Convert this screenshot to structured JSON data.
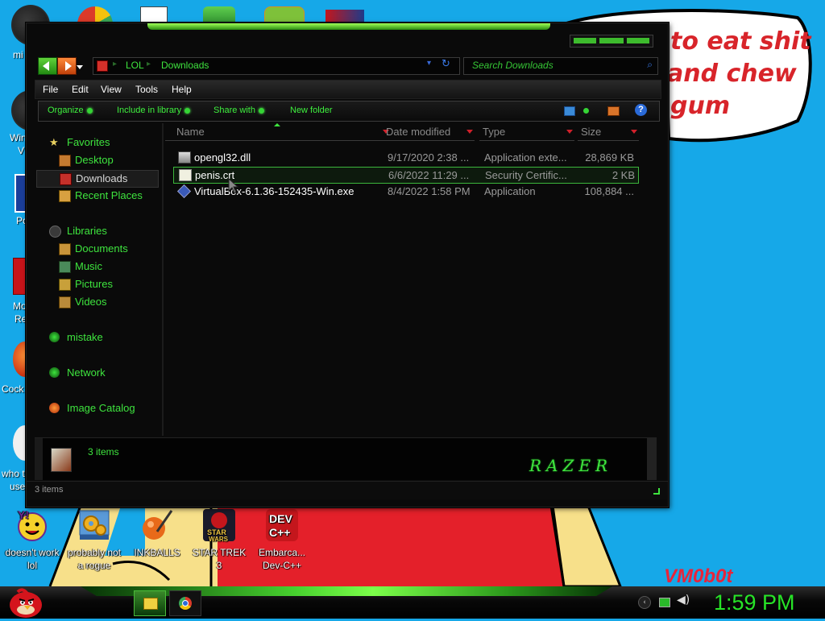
{
  "wallpaper": {
    "bubble_lines": [
      "to eat shit",
      "and chew",
      "gum"
    ],
    "signature": "VM0b0t"
  },
  "desktop_icons": [
    {
      "label": "doesn't work lol",
      "icon": "yahoo-messenger-icon"
    },
    {
      "label": "probably not a rogue",
      "icon": "gears-installer-icon"
    },
    {
      "label": "INKBALLS",
      "icon": "inkballs-icon"
    },
    {
      "label": "STAR TREK 3",
      "icon": "star-trek-icon"
    },
    {
      "label": "Embarca... Dev-C++",
      "icon": "dev-cpp-icon"
    }
  ],
  "desktop_cut_labels": [
    "mi",
    "Win",
    "V",
    "Po",
    "Mo",
    "Re",
    "Cock",
    "who t",
    "use"
  ],
  "window": {
    "address": {
      "root": "LOL",
      "current": "Downloads"
    },
    "search_placeholder": "Search Downloads",
    "menu": [
      "File",
      "Edit",
      "View",
      "Tools",
      "Help"
    ],
    "toolbar": [
      "Organize",
      "Include in library",
      "Share with",
      "New folder"
    ],
    "nav": {
      "favorites": "Favorites",
      "desktop": "Desktop",
      "downloads": "Downloads",
      "recent": "Recent Places",
      "libraries": "Libraries",
      "documents": "Documents",
      "music": "Music",
      "pictures": "Pictures",
      "videos": "Videos",
      "mistake": "mistake",
      "network": "Network",
      "image_catalog": "Image Catalog"
    },
    "columns": {
      "name": "Name",
      "date": "Date modified",
      "type": "Type",
      "size": "Size"
    },
    "files": [
      {
        "name": "opengl32.dll",
        "date": "9/17/2020 2:38 ...",
        "type": "Application exte...",
        "size": "28,869 KB"
      },
      {
        "name": "penis.crt",
        "date": "6/6/2022 11:29 ...",
        "type": "Security Certific...",
        "size": "2 KB"
      },
      {
        "name": "VirtualBox-6.1.36-152435-Win.exe",
        "date": "8/4/2022 1:58 PM",
        "type": "Application",
        "size": "108,884 ..."
      }
    ],
    "details_count": "3 items",
    "status_count": "3 items",
    "brand": "RAZER",
    "colors": {
      "accent": "#3ee43e",
      "background": "#0a0a0a",
      "sort_arrow": "#d0202a"
    }
  },
  "taskbar": {
    "clock": "1:59 PM",
    "pinned": [
      "explorer-icon",
      "chrome-icon"
    ]
  }
}
